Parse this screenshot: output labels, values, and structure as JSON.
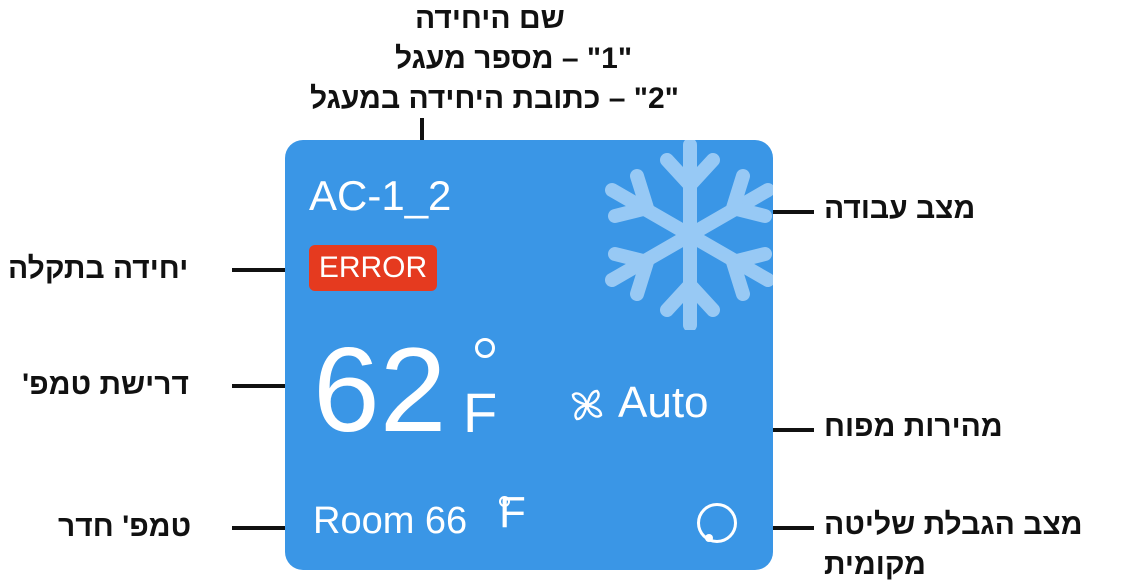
{
  "card": {
    "unit_name": "AC-1_2",
    "error_label": "ERROR",
    "set_temp": "62",
    "temp_unit": "F",
    "fan_speed": "Auto",
    "room_label": "Room 66",
    "room_unit": "F",
    "mode_icon": "snowflake-icon",
    "fan_icon": "fan-icon",
    "lock_icon": "local-control-lock-icon",
    "bg_color": "#3a96e6",
    "error_color": "#e53a1f"
  },
  "callouts": {
    "name_line1": "שם היחידה",
    "name_line2": "\"1\" – מספר מעגל",
    "name_line3": "\"2\" – כתובת היחידה במעגל",
    "mode": "מצב עבודה",
    "error": "יחידה בתקלה",
    "set_temp": "דרישת טמפ'",
    "fan_speed": "מהירות מפוח",
    "room_temp": "טמפ' חדר",
    "lock_line1": "מצב הגבלת שליטה",
    "lock_line2": "מקומית"
  }
}
